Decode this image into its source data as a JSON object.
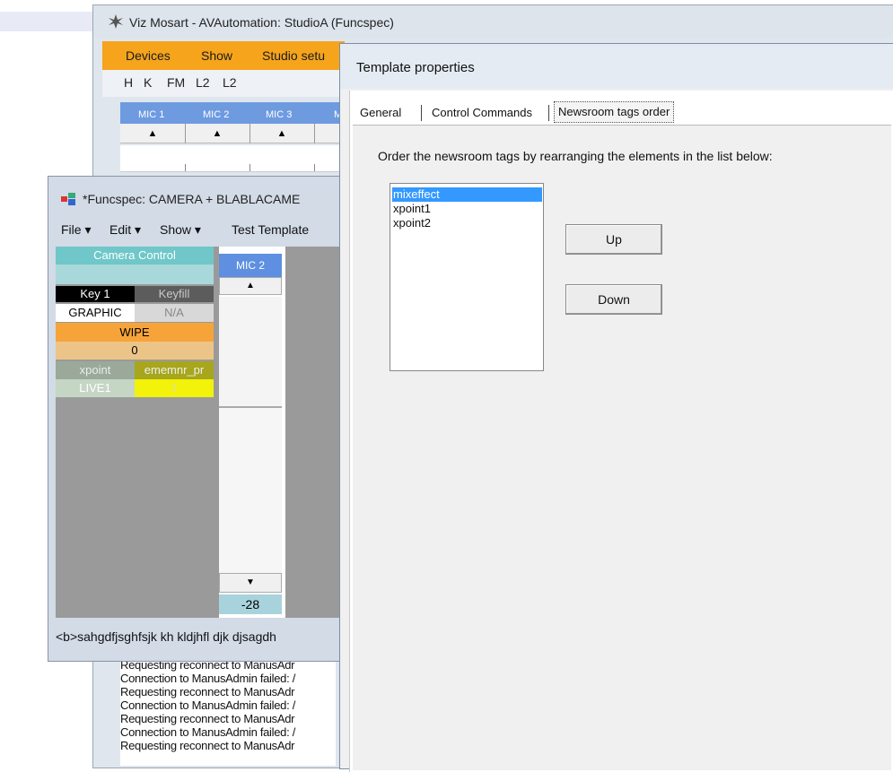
{
  "main_window": {
    "title": "Viz Mosart - AVAutomation: StudioA (Funcspec)",
    "menu": [
      "Devices",
      "Show",
      "Studio setu"
    ],
    "toolbar": [
      "H",
      "K",
      "FM",
      "L2",
      "L2"
    ],
    "mic_labels": [
      "MIC 1",
      "MIC 2",
      "MIC 3",
      "M"
    ],
    "log_lines": [
      "Requesting reconnect to ManusAdr",
      "Connection to ManusAdmin failed: /",
      "Requesting reconnect to ManusAdr",
      "Connection to ManusAdmin failed: /",
      "Requesting reconnect to ManusAdr",
      "Connection to ManusAdmin failed: /",
      "Requesting reconnect to ManusAdr"
    ]
  },
  "funcspec_window": {
    "title": "*Funcspec: CAMERA + BLABLACAME",
    "menu": [
      "File ▾",
      "Edit ▾",
      "Show ▾",
      "Test Template"
    ],
    "camera_control": "Camera Control",
    "key1": "Key 1",
    "keyfill": "Keyfill",
    "graphic": "GRAPHIC",
    "na": "N/A",
    "wipe": "WIPE",
    "wipe_value": "0",
    "xpoint": "xpoint",
    "ememnr": "ememnr_pr",
    "live": "LIVE1",
    "live_value": "1",
    "fader": {
      "label": "MIC 2",
      "up": "▲",
      "down": "▼",
      "value": "-28"
    },
    "status_text": "<b>sahgdfjsghfsjk kh kldjhfl djk djsagdh"
  },
  "dialog": {
    "title": "Template properties",
    "tabs": [
      "General",
      "Control Commands",
      "Newsroom tags order"
    ],
    "active_tab": "Newsroom tags order",
    "instruction": "Order the newsroom tags by rearranging the elements in the list below:",
    "list_items": [
      "mixeffect",
      "xpoint1",
      "xpoint2"
    ],
    "selected_item": "mixeffect",
    "up_label": "Up",
    "down_label": "Down"
  },
  "colors": {
    "menu_orange": "#f5a41c",
    "mic_blue": "#6e9ae0",
    "selection_blue": "#3399ff"
  },
  "icons": [
    "app-logo-icon",
    "funcspec-window-icon",
    "arrow-up-icon",
    "arrow-down-icon"
  ]
}
